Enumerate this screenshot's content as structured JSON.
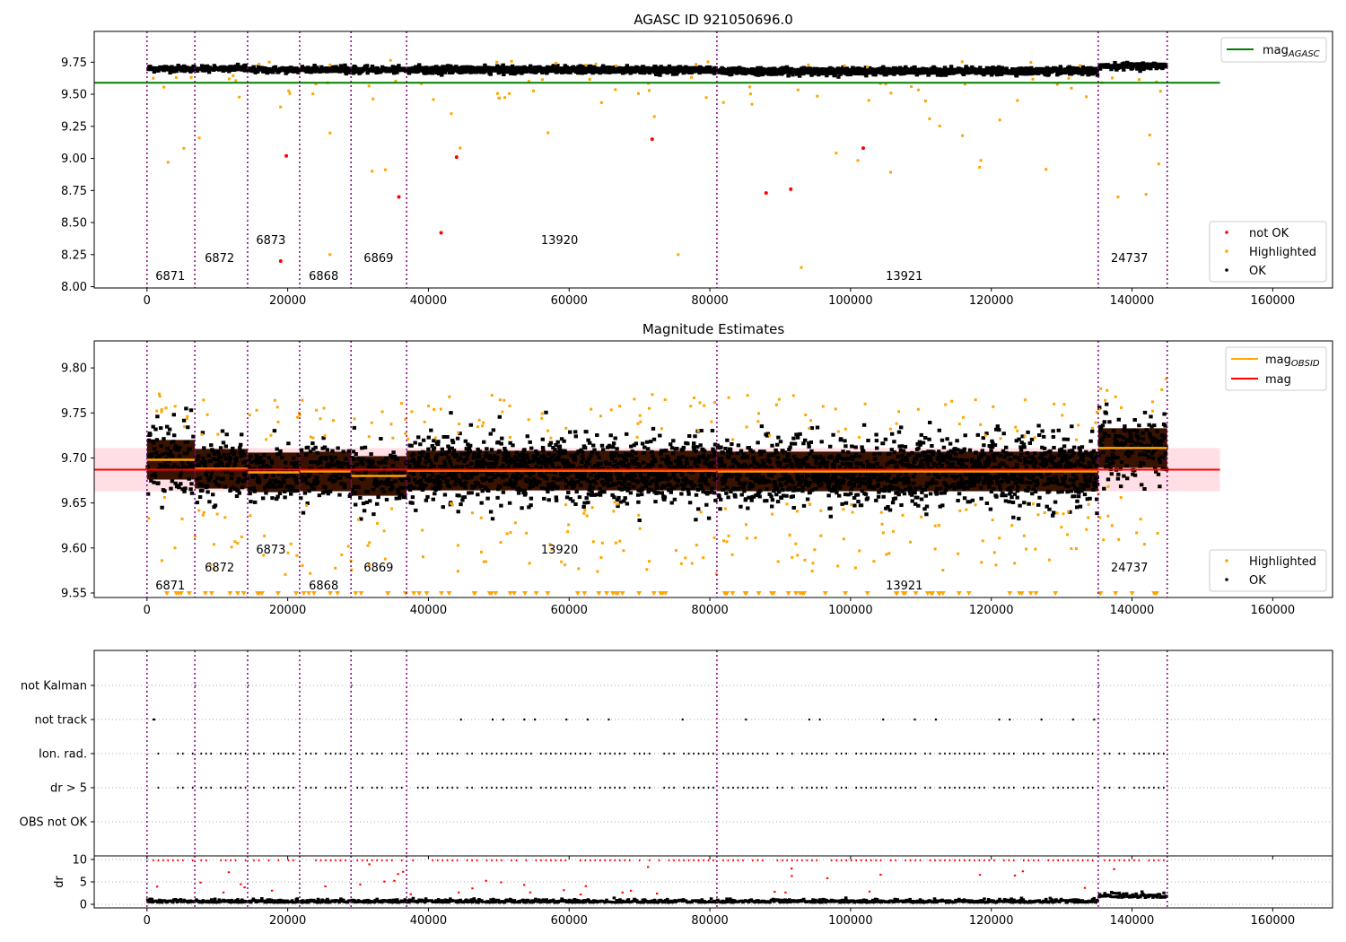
{
  "panel1": {
    "title": "AGASC ID 921050696.0",
    "xlim": [
      -7500,
      168500
    ],
    "ylim": [
      7.99,
      9.99
    ],
    "xticks": [
      "0",
      "20000",
      "40000",
      "60000",
      "80000",
      "100000",
      "120000",
      "140000",
      "160000"
    ],
    "xtick_values": [
      0,
      20000,
      40000,
      60000,
      80000,
      100000,
      120000,
      140000,
      160000
    ],
    "yticks": [
      "8.00",
      "8.25",
      "8.50",
      "8.75",
      "9.00",
      "9.25",
      "9.50",
      "9.75"
    ],
    "ytick_values": [
      8.0,
      8.25,
      8.5,
      8.75,
      9.0,
      9.25,
      9.5,
      9.75
    ],
    "agasc_mag": 9.59,
    "legend_top": {
      "label_main": "mag",
      "label_sub": "AGASC",
      "color": "#008000"
    },
    "legend_bottom": [
      {
        "label": "not OK",
        "color": "#ff0000"
      },
      {
        "label": "Highlighted",
        "color": "#ffa500"
      },
      {
        "label": "OK",
        "color": "#000000"
      }
    ],
    "not_ok_points": [
      [
        19800,
        9.02
      ],
      [
        19000,
        8.2
      ],
      [
        35800,
        8.7
      ],
      [
        41800,
        8.42
      ],
      [
        44000,
        9.01
      ],
      [
        71800,
        9.15
      ],
      [
        88000,
        8.73
      ],
      [
        91500,
        8.76
      ],
      [
        101800,
        9.08
      ]
    ]
  },
  "panel2": {
    "title": "Magnitude Estimates",
    "ylim": [
      9.545,
      9.83
    ],
    "yticks": [
      "9.55",
      "9.60",
      "9.65",
      "9.70",
      "9.75",
      "9.80"
    ],
    "ytick_values": [
      9.55,
      9.6,
      9.65,
      9.7,
      9.75,
      9.8
    ],
    "mean_mag": 9.687,
    "mean_band": [
      9.663,
      9.711
    ],
    "legend_top": [
      {
        "label_main": "mag",
        "label_sub": "OBSID",
        "color": "#ffa500"
      },
      {
        "label_main": "mag",
        "label_sub": "",
        "color": "#ff0000"
      }
    ],
    "legend_bottom": [
      {
        "label": "Highlighted",
        "color": "#ffa500"
      },
      {
        "label": "OK",
        "color": "#000000"
      }
    ],
    "obsid_mags": [
      9.698,
      9.688,
      9.684,
      9.685,
      9.68,
      9.686,
      9.685,
      9.711
    ]
  },
  "panel3": {
    "categories": [
      "not Kalman",
      "not track",
      "Ion. rad.",
      "dr > 5",
      "OBS not OK"
    ],
    "dr_ylabel": "dr",
    "dr_yticks": [
      "0",
      "5",
      "10"
    ],
    "dr_ytick_values": [
      0,
      5,
      10
    ]
  },
  "observations": [
    {
      "obsid": "6871",
      "start": 0,
      "end": 6800,
      "label_x": 1200,
      "level": 0
    },
    {
      "obsid": "6872",
      "start": 6800,
      "end": 14300,
      "label_x": 8200,
      "level": 1
    },
    {
      "obsid": "6873",
      "start": 14300,
      "end": 21700,
      "label_x": 15500,
      "level": 2
    },
    {
      "obsid": "6868",
      "start": 21700,
      "end": 29000,
      "label_x": 23000,
      "level": 0
    },
    {
      "obsid": "6869",
      "start": 29000,
      "end": 36900,
      "label_x": 30800,
      "level": 1
    },
    {
      "obsid": "13920",
      "start": 36900,
      "end": 81000,
      "label_x": 56000,
      "level": 2
    },
    {
      "obsid": "13921",
      "start": 81000,
      "end": 135200,
      "label_x": 105000,
      "level": 0
    },
    {
      "obsid": "24737",
      "start": 135200,
      "end": 145000,
      "label_x": 137000,
      "level": 1
    }
  ]
}
